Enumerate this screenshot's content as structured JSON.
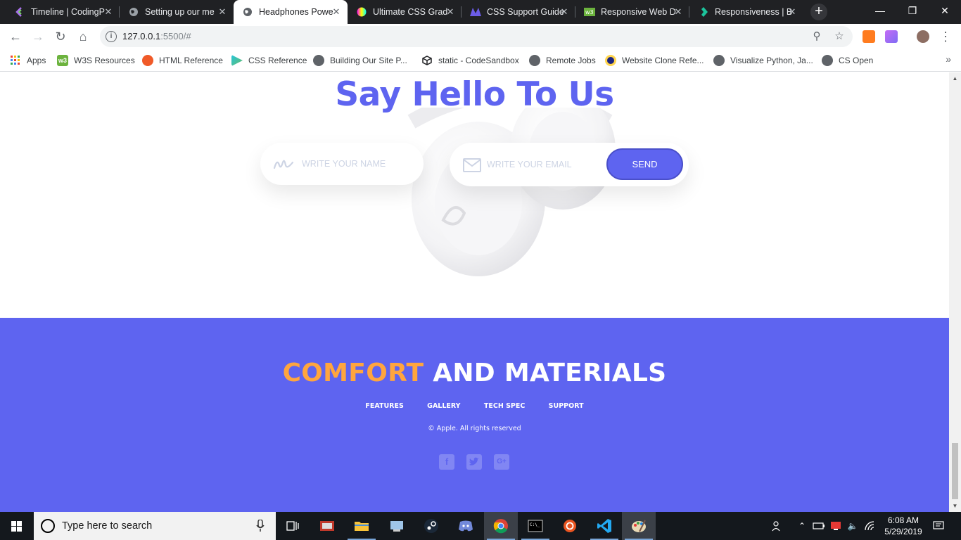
{
  "browser": {
    "tabs": [
      {
        "title": "Timeline | CodingP",
        "icon": "codingphase-icon",
        "active": false
      },
      {
        "title": "Setting up our me",
        "icon": "globe-icon",
        "active": false
      },
      {
        "title": "Headphones Powe",
        "icon": "globe-icon",
        "active": true
      },
      {
        "title": "Ultimate CSS Grad",
        "icon": "gradient-icon",
        "active": false
      },
      {
        "title": "CSS Support Guide",
        "icon": "css-guide-icon",
        "active": false
      },
      {
        "title": "Responsive Web D",
        "icon": "w3-icon",
        "active": false
      },
      {
        "title": "Responsiveness | B",
        "icon": "bootstrap-icon",
        "active": false
      }
    ],
    "url_host": "127.0.0.1",
    "url_rest": ":5500/#",
    "bookmarks": [
      {
        "label": "Apps",
        "icon": "apps-grid-icon"
      },
      {
        "label": "W3S Resources",
        "icon": "w3-icon"
      },
      {
        "label": "HTML Reference",
        "icon": "html-icon"
      },
      {
        "label": "CSS Reference",
        "icon": "css-icon"
      },
      {
        "label": "Building Our Site P...",
        "icon": "globe-icon"
      },
      {
        "label": "static - CodeSandbox",
        "icon": "codesandbox-icon"
      },
      {
        "label": "Remote Jobs",
        "icon": "globe-icon"
      },
      {
        "label": "Website Clone Refe...",
        "icon": "circle-icon"
      },
      {
        "label": "Visualize Python, Ja...",
        "icon": "globe-icon"
      },
      {
        "label": "CS Open",
        "icon": "globe-icon"
      }
    ]
  },
  "page": {
    "contact": {
      "title": "Say Hello To Us",
      "name_placeholder": "WRITE YOUR NAME",
      "email_placeholder": "WRITE YOUR EMAIL",
      "send_label": "SEND"
    },
    "footer": {
      "title_accent": "COMFORT",
      "title_rest": "AND MATERIALS",
      "nav": [
        "FEATURES",
        "GALLERY",
        "TECH SPEC",
        "SUPPORT"
      ],
      "copyright": "© Apple. All rights reserved",
      "social": [
        "facebook-icon",
        "twitter-icon",
        "google-plus-icon"
      ]
    },
    "colors": {
      "primary": "#5e64f0",
      "accent": "#ffa53e"
    }
  },
  "taskbar": {
    "search_placeholder": "Type here to search",
    "time": "6:08 AM",
    "date": "5/29/2019"
  }
}
